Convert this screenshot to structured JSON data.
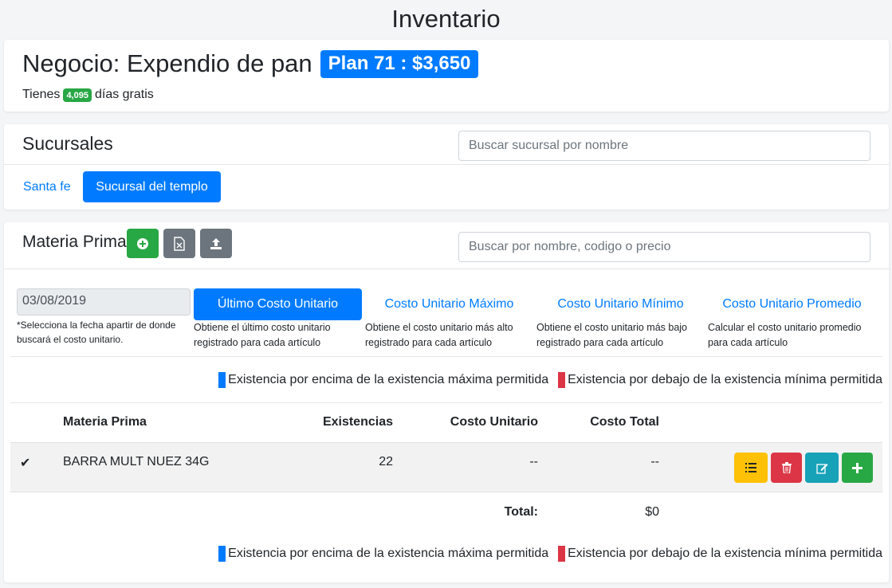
{
  "page": {
    "title": "Inventario"
  },
  "business": {
    "name": "Negocio: Expendio de pan",
    "plan": "Plan 71 : $3,650",
    "free_prefix": "Tienes",
    "free_days": "4,095",
    "free_suffix": "días gratis"
  },
  "branches": {
    "title": "Sucursales",
    "search_placeholder": "Buscar sucursal por nombre",
    "items": [
      {
        "label": "Santa fe",
        "active": false
      },
      {
        "label": "Sucursal del templo",
        "active": true
      }
    ]
  },
  "materials": {
    "title": "Materia Prima",
    "search_placeholder": "Buscar por nombre, codigo o precio",
    "toolbar_icons": [
      "add-circle-icon",
      "excel-file-icon",
      "upload-icon"
    ],
    "date_value": "03/08/2019",
    "date_hint": "*Selecciona la fecha apartir de donde buscará el costo unitario.",
    "modes": [
      {
        "label": "Último Costo Unitario",
        "desc": "Obtiene el último costo unitario registrado para cada artículo",
        "active": true
      },
      {
        "label": "Costo Unitario Máximo",
        "desc": "Obtiene el costo unitario más alto registrado para cada artículo",
        "active": false
      },
      {
        "label": "Costo Unitario Mínimo",
        "desc": "Obtiene el costo unitario más bajo registrado para cada artículo",
        "active": false
      },
      {
        "label": "Costo Unitario Promedio",
        "desc": "Calcular el costo unitario promedio para cada artículo",
        "active": false
      }
    ],
    "legend": {
      "above": "Existencia por encima de la existencia máxima permitida",
      "below": "Existencia por debajo de la existencia mínima permitida",
      "above_color": "#007bff",
      "below_color": "#dc3545"
    },
    "table": {
      "headers": [
        "Materia Prima",
        "Existencias",
        "Costo Unitario",
        "Costo Total"
      ],
      "rows": [
        {
          "check": "✔",
          "name": "BARRA MULT NUEZ 34G",
          "stock": "22",
          "unit_cost": "--",
          "total_cost": "--"
        }
      ],
      "total_label": "Total:",
      "total_value": "$0"
    },
    "row_actions": [
      {
        "icon": "list-icon",
        "color": "#ffc107"
      },
      {
        "icon": "trash-icon",
        "color": "#dc3545"
      },
      {
        "icon": "edit-icon",
        "color": "#17a2b8"
      },
      {
        "icon": "plus-icon",
        "color": "#28a745"
      }
    ]
  }
}
